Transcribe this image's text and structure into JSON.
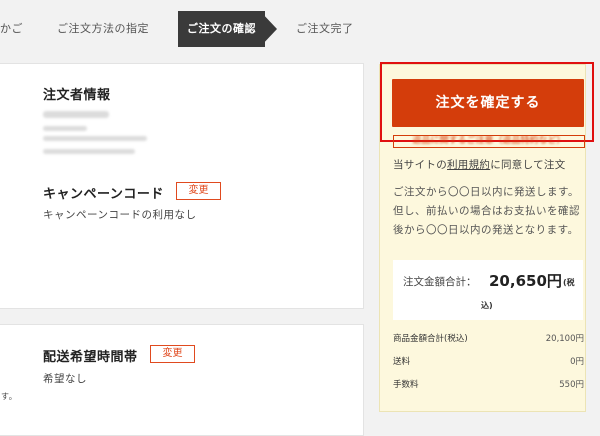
{
  "steps": {
    "cart": "かご",
    "method": "ご注文方法の指定",
    "confirm": "ご注文の確認",
    "complete": "ご注文完了"
  },
  "orderer": {
    "title": "注文者情報"
  },
  "campaign": {
    "title": "キャンペーンコード",
    "change": "変更",
    "value": "キャンペーンコードの利用なし"
  },
  "delivery": {
    "title": "配送希望時間帯",
    "change": "変更",
    "value": "希望なし",
    "note_fragment": "す。"
  },
  "sidebar": {
    "confirm_button": "注文を確定する",
    "returns_link": "返品に関するご注意（返品特約など）",
    "agree_prefix": "当サイトの",
    "terms_link": "利用規約",
    "agree_suffix": "に同意して注文",
    "shipping_notice": "ご注文から〇〇日以内に発送します。但し、前払いの場合はお支払いを確認後から〇〇日以内の発送となります。",
    "total_label": "注文金額合計：",
    "total_amount": "20,650円",
    "tax_part1": "(税",
    "tax_part2": "込)",
    "rows": [
      {
        "label": "商品金額合計(税込)",
        "value": "20,100円"
      },
      {
        "label": "送料",
        "value": "0円"
      },
      {
        "label": "手数料",
        "value": "550円"
      }
    ]
  }
}
